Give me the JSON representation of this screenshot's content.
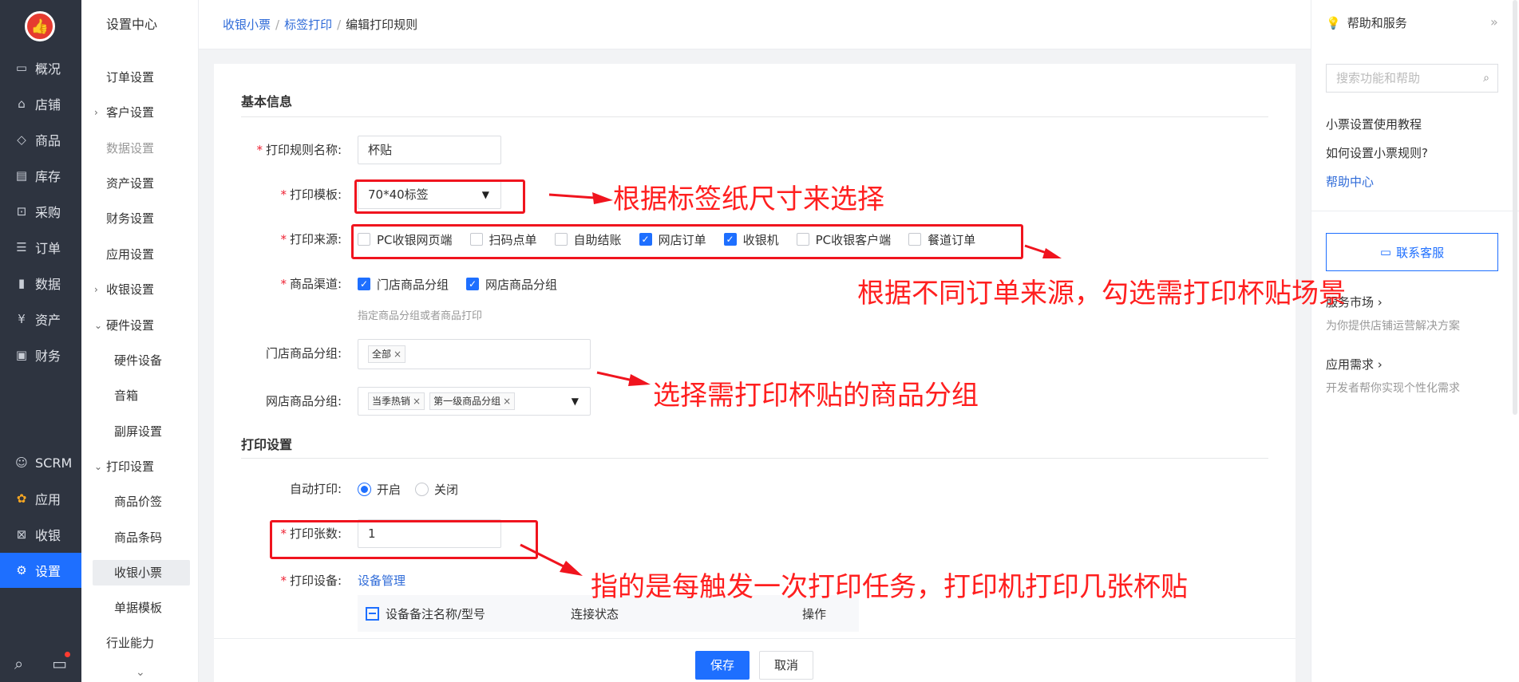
{
  "nav": {
    "items": [
      {
        "label": "概况",
        "icon": "monitor-icon"
      },
      {
        "label": "店铺",
        "icon": "store-icon"
      },
      {
        "label": "商品",
        "icon": "tag-icon"
      },
      {
        "label": "库存",
        "icon": "inventory-icon"
      },
      {
        "label": "采购",
        "icon": "purchase-icon"
      },
      {
        "label": "订单",
        "icon": "order-icon"
      },
      {
        "label": "数据",
        "icon": "bar-chart-icon"
      },
      {
        "label": "资产",
        "icon": "yen-icon"
      },
      {
        "label": "财务",
        "icon": "wallet-icon"
      }
    ],
    "lower_items": [
      {
        "label": "SCRM",
        "icon": "person-icon"
      },
      {
        "label": "应用",
        "icon": "apps-icon"
      },
      {
        "label": "收银",
        "icon": "cashier-icon"
      },
      {
        "label": "设置",
        "icon": "gear-icon"
      }
    ]
  },
  "submenu": {
    "head": "设置中心",
    "items": [
      {
        "label": "订单设置"
      },
      {
        "label": "客户设置"
      },
      {
        "label": "数据设置"
      },
      {
        "label": "资产设置"
      },
      {
        "label": "财务设置"
      },
      {
        "label": "应用设置"
      },
      {
        "label": "收银设置"
      },
      {
        "label": "硬件设置"
      },
      {
        "label": "硬件设备"
      },
      {
        "label": "音箱"
      },
      {
        "label": "副屏设置"
      },
      {
        "label": "打印设置"
      },
      {
        "label": "商品价签"
      },
      {
        "label": "商品条码"
      },
      {
        "label": "收银小票"
      },
      {
        "label": "单据模板"
      },
      {
        "label": "行业能力"
      }
    ]
  },
  "breadcrumb": {
    "level1": "收银小票",
    "level2": "标签打印",
    "current": "编辑打印规则",
    "sep": "/"
  },
  "form": {
    "basic_title": "基本信息",
    "rule_name_label": "打印规则名称:",
    "rule_name_value": "杯贴",
    "template_label": "打印模板:",
    "template_value": "70*40标签",
    "source_label": "打印来源:",
    "sources": [
      {
        "label": "PC收银网页端",
        "checked": false
      },
      {
        "label": "扫码点单",
        "checked": false
      },
      {
        "label": "自助结账",
        "checked": false
      },
      {
        "label": "网店订单",
        "checked": true
      },
      {
        "label": "收银机",
        "checked": true
      },
      {
        "label": "PC收银客户端",
        "checked": false
      },
      {
        "label": "餐道订单",
        "checked": false
      }
    ],
    "channel_label": "商品渠道:",
    "channels": [
      {
        "label": "门店商品分组",
        "checked": true
      },
      {
        "label": "网店商品分组",
        "checked": true
      }
    ],
    "channel_hint": "指定商品分组或者商品打印",
    "store_group_label": "门店商品分组:",
    "store_group_tags": [
      "全部"
    ],
    "online_group_label": "网店商品分组:",
    "online_group_tags": [
      "当季热销",
      "第一级商品分组"
    ],
    "print_title": "打印设置",
    "auto_print_label": "自动打印:",
    "auto_print_on": "开启",
    "auto_print_off": "关闭",
    "copies_label": "打印张数:",
    "copies_value": "1",
    "device_label": "打印设备:",
    "device_link": "设备管理",
    "table_headers": [
      "设备备注名称/型号",
      "连接状态",
      "操作"
    ]
  },
  "footer": {
    "save": "保存",
    "cancel": "取消"
  },
  "help": {
    "title": "帮助和服务",
    "collapse": "»",
    "search_placeholder": "搜索功能和帮助",
    "links": [
      "小票设置使用教程",
      "如何设置小票规则?"
    ],
    "help_center": "帮助中心",
    "contact": "联系客服",
    "market_title": "服务市场 ›",
    "market_desc": "为你提供店铺运营解决方案",
    "needs_title": "应用需求 ›",
    "needs_desc": "开发者帮你实现个性化需求"
  },
  "annotations": {
    "template": "根据标签纸尺寸来选择",
    "source": "根据不同订单来源，勾选需打印杯贴场景",
    "groups": "选择需打印杯贴的商品分组",
    "copies": "指的是每触发一次打印任务，打印机打印几张杯贴",
    "color": "#f0141e"
  },
  "colors": {
    "accent": "#1e6fff",
    "nav_bg": "#2e3440",
    "link": "#2f6bd8"
  }
}
